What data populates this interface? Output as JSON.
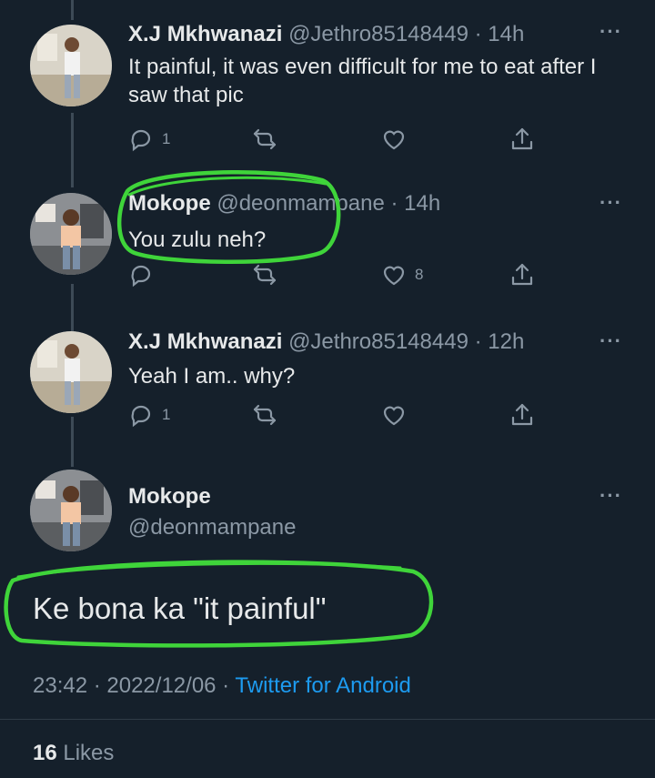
{
  "tweets": [
    {
      "name": "X.J Mkhwanazi",
      "handle": "@Jethro85148449",
      "sep": " · ",
      "time": "14h",
      "more": "···",
      "text": "It painful, it was even difficult for me to eat after I saw that pic",
      "reply_count": "1",
      "like_count": ""
    },
    {
      "name": "Mokope",
      "handle": "@deonmampane",
      "sep": " · ",
      "time": "14h",
      "more": "···",
      "text": "You zulu neh?",
      "reply_count": "",
      "like_count": "8"
    },
    {
      "name": "X.J Mkhwanazi",
      "handle": "@Jethro85148449",
      "sep": " · ",
      "time": "12h",
      "more": "···",
      "text": "Yeah I am.. why?",
      "reply_count": "1",
      "like_count": ""
    }
  ],
  "main": {
    "name": "Mokope",
    "handle": "@deonmampane",
    "more": "···",
    "text": "Ke bona ka \"it painful\"",
    "time": "23:42",
    "sep": " · ",
    "date": "2022/12/06",
    "source": "Twitter for Android",
    "like_count": "16",
    "likes_label": "Likes"
  },
  "colors": {
    "background": "#15202b",
    "muted": "#8b98a5",
    "link": "#1d9bf0",
    "annotation": "#3fd43a"
  },
  "icons": [
    "reply-icon",
    "retweet-icon",
    "heart-icon",
    "share-icon",
    "more-icon"
  ]
}
